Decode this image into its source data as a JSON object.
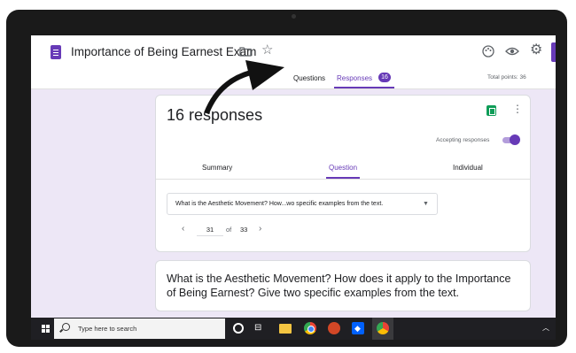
{
  "app": {
    "title": "Importance of Being Earnest Exam",
    "icons": {
      "forms": "google-forms-icon",
      "folder": "folder-icon",
      "star": "star-icon",
      "palette": "palette-icon",
      "preview": "eye-icon",
      "settings": "gear-icon"
    }
  },
  "tabs": {
    "questions": "Questions",
    "responses": "Responses",
    "responses_badge": "16",
    "active": "responses"
  },
  "total_points": "Total points: 36",
  "responses_card": {
    "count_label": "16 responses",
    "accepting_label": "Accepting responses",
    "accepting": true,
    "subtabs": [
      "Summary",
      "Question",
      "Individual"
    ],
    "active_subtab": "Question",
    "question_select": "What is the Aesthetic Movement? How...wo specific examples from the text.",
    "pager": {
      "current": "31",
      "of": "of",
      "total": "33"
    }
  },
  "question": {
    "text": "What is the Aesthetic Movement? How does it apply to the Importance of Being Earnest? Give two specific examples from the text."
  },
  "taskbar": {
    "search_placeholder": "Type here to search",
    "icons": [
      "windows-icon",
      "search-icon",
      "cortana-icon",
      "task-view-icon",
      "file-explorer-icon",
      "chrome-icon",
      "powerpoint-icon",
      "dropbox-icon",
      "app-icon",
      "tray-chevron-icon"
    ]
  },
  "colors": {
    "accent": "#673ab7",
    "background": "#ede7f6",
    "sheets": "#0f9d58",
    "taskbar": "#1f1f23"
  }
}
